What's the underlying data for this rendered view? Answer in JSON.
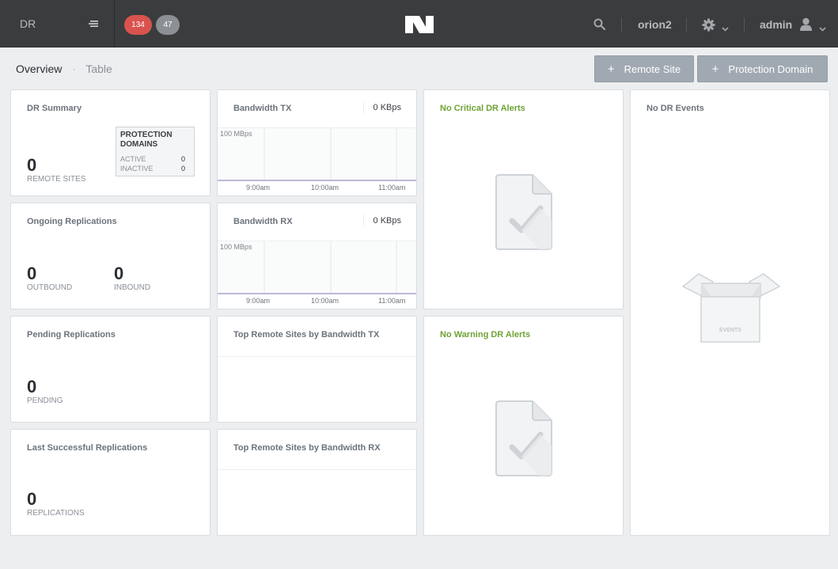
{
  "topbar": {
    "app_name": "DR",
    "critical_count": "134",
    "warning_count": "47",
    "cluster_name": "orion2",
    "user_name": "admin"
  },
  "tabs": {
    "overview": "Overview",
    "separator": "·",
    "table": "Table"
  },
  "actions": {
    "remote_site": "Remote Site",
    "protection_domain": "Protection Domain",
    "plus": "+"
  },
  "dr_summary": {
    "title": "DR Summary",
    "remote_sites_value": "0",
    "remote_sites_label": "REMOTE SITES",
    "pd_title": "PROTECTION DOMAINS",
    "active_label": "ACTIVE",
    "active_value": "0",
    "inactive_label": "INACTIVE",
    "inactive_value": "0"
  },
  "ongoing": {
    "title": "Ongoing Replications",
    "outbound_value": "0",
    "outbound_label": "OUTBOUND",
    "inbound_value": "0",
    "inbound_label": "INBOUND"
  },
  "pending": {
    "title": "Pending Replications",
    "value": "0",
    "label": "PENDING"
  },
  "last_successful": {
    "title": "Last Successful Replications",
    "value": "0",
    "label": "REPLICATIONS"
  },
  "bandwidth_tx": {
    "title": "Bandwidth TX",
    "value": "0 KBps",
    "y_label": "100 MBps",
    "x_labels": [
      "9:00am",
      "10:00am",
      "11:00am"
    ]
  },
  "bandwidth_rx": {
    "title": "Bandwidth RX",
    "value": "0 KBps",
    "y_label": "100 MBps",
    "x_labels": [
      "9:00am",
      "10:00am",
      "11:00am"
    ]
  },
  "top_tx": {
    "title": "Top Remote Sites by Bandwidth TX"
  },
  "top_rx": {
    "title": "Top Remote Sites by Bandwidth RX"
  },
  "critical_alerts": {
    "title": "No Critical DR Alerts"
  },
  "warning_alerts": {
    "title": "No Warning DR Alerts"
  },
  "events": {
    "title": "No DR Events",
    "box_label": "EVENTS"
  },
  "colors": {
    "topbar": "#3b3c3e",
    "critical_badge": "#d9534f",
    "warning_badge": "#8b9095",
    "button": "#a0a9b1",
    "green_title": "#6ea335"
  }
}
